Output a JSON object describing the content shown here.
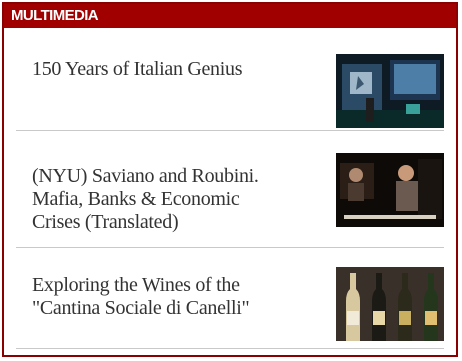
{
  "widget": {
    "title": "MULTIMEDIA",
    "items": [
      {
        "title": "150 Years of Italian Genius",
        "thumbnail": "video-thumbnail-presentation"
      },
      {
        "title": "(NYU) Saviano and Roubini. Mafia, Banks & Economic Crises (Translated)",
        "thumbnail": "video-thumbnail-lecture"
      },
      {
        "title": "Exploring the Wines of the \"Cantina Sociale di Canelli\"",
        "thumbnail": "video-thumbnail-wine-bottles"
      }
    ]
  },
  "colors": {
    "header_bg": "#a00000",
    "border": "#8a0000",
    "text": "#333333",
    "divider": "#c9c9c9"
  }
}
